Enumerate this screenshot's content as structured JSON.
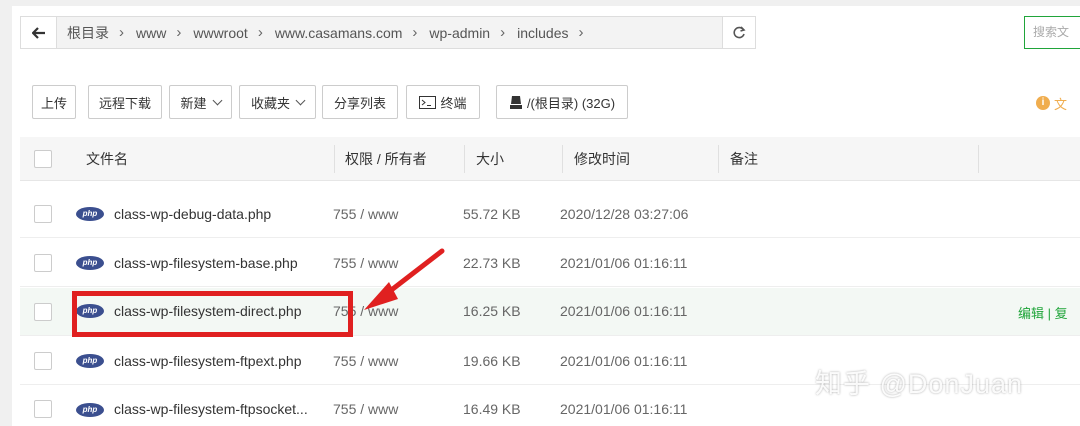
{
  "breadcrumbs": [
    "根目录",
    "www",
    "wwwroot",
    "www.casamans.com",
    "wp-admin",
    "includes"
  ],
  "search": {
    "placeholder": "搜索文"
  },
  "toolbar": {
    "upload": "上传",
    "remote_download": "远程下载",
    "new": "新建",
    "favorites": "收藏夹",
    "share_list": "分享列表",
    "terminal": "终端",
    "disk": "/(根目录) (32G)",
    "info_text": "文"
  },
  "table": {
    "headers": {
      "name": "文件名",
      "perm": "权限 / 所有者",
      "size": "大小",
      "mtime": "修改时间",
      "note": "备注"
    },
    "rows": [
      {
        "name": "class-wp-debug-data.php",
        "perm": "755 / www",
        "size": "55.72 KB",
        "mtime": "2020/12/28 03:27:06"
      },
      {
        "name": "class-wp-filesystem-base.php",
        "perm": "755 / www",
        "size": "22.73 KB",
        "mtime": "2021/01/06 01:16:11"
      },
      {
        "name": "class-wp-filesystem-direct.php",
        "perm": "755 / www",
        "size": "16.25 KB",
        "mtime": "2021/01/06 01:16:11",
        "actions": "编辑 | 复"
      },
      {
        "name": "class-wp-filesystem-ftpext.php",
        "perm": "755 / www",
        "size": "19.66 KB",
        "mtime": "2021/01/06 01:16:11"
      },
      {
        "name": "class-wp-filesystem-ftpsocket...",
        "perm": "755 / www",
        "size": "16.49 KB",
        "mtime": "2021/01/06 01:16:11"
      }
    ]
  },
  "file_icon_label": "php",
  "watermark": "知乎 @DonJuan",
  "colors": {
    "accent": "#20a53a",
    "annotation": "#e02020",
    "php_badge": "#3b4f8f"
  }
}
